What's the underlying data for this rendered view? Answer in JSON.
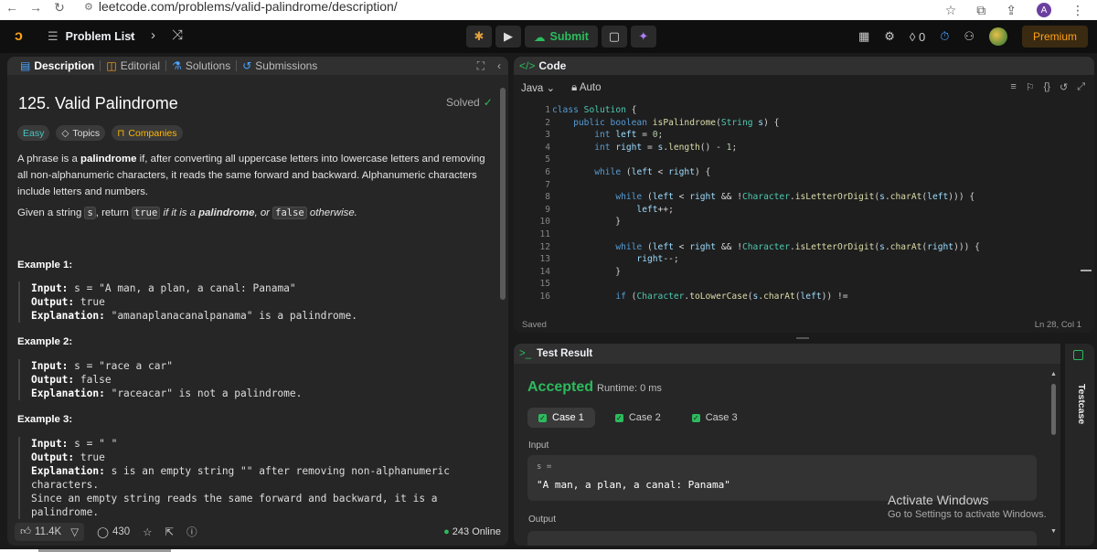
{
  "browser": {
    "url": "leetcode.com/problems/valid-palindrome/description/",
    "account_initial": "A"
  },
  "topnav": {
    "problem_list": "Problem List",
    "submit": "Submit",
    "streak_count": "0",
    "premium": "Premium"
  },
  "left_tabs": [
    {
      "label": "Description",
      "icon": "file-icon"
    },
    {
      "label": "Editorial",
      "icon": "book-icon"
    },
    {
      "label": "Solutions",
      "icon": "flask-icon"
    },
    {
      "label": "Submissions",
      "icon": "history-icon"
    }
  ],
  "problem": {
    "title": "125. Valid Palindrome",
    "status": "Solved",
    "difficulty": "Easy",
    "topics": "Topics",
    "companies": "Companies",
    "desc_a": "A phrase is a ",
    "desc_b": "palindrome",
    "desc_c": " if, after converting all uppercase letters into lowercase letters and removing all non-alphanumeric characters, it reads the same forward and backward. Alphanumeric characters include letters and numbers.",
    "q1": "Given a string ",
    "q_s": "s",
    "q2": ", return ",
    "q_true": "true",
    "q3": " if it is a ",
    "q_pal": "palindrome",
    "q4": ", or ",
    "q_false": "false",
    "q5": " otherwise.",
    "examples": [
      {
        "heading": "Example 1:",
        "input": "s = \"A man, a plan, a canal: Panama\"",
        "output": "true",
        "explanation": "\"amanaplanacanalpanama\" is a palindrome."
      },
      {
        "heading": "Example 2:",
        "input": "s = \"race a car\"",
        "output": "false",
        "explanation": "\"raceacar\" is not a palindrome."
      },
      {
        "heading": "Example 3:",
        "input": "s = \" \"",
        "output": "true",
        "explanation": "s is an empty string \"\" after removing non-alphanumeric characters.",
        "explanation2": "Since an empty string reads the same forward and backward, it is a palindrome."
      }
    ],
    "labels": {
      "input": "Input:",
      "output": "Output:",
      "explanation": "Explanation:"
    }
  },
  "footer": {
    "likes": "11.4K",
    "comments": "430",
    "online": "243 Online"
  },
  "code": {
    "header": "Code",
    "language": "Java",
    "mode": "Auto",
    "saved": "Saved",
    "cursor": "Ln 28, Col 1",
    "line_numbers": [
      "1",
      "2",
      "3",
      "4",
      "5",
      "6",
      "7",
      "8",
      "9",
      "10",
      "11",
      "12",
      "13",
      "14",
      "15",
      "16"
    ]
  },
  "result": {
    "header": "Test Result",
    "verdict": "Accepted",
    "runtime": "Runtime: 0 ms",
    "cases": [
      "Case 1",
      "Case 2",
      "Case 3"
    ],
    "input_label": "Input",
    "var_label": "s =",
    "input_value": "\"A man, a plan, a canal: Panama\"",
    "output_label": "Output"
  },
  "side_tab": "Testcase",
  "watermark": {
    "line1": "Activate Windows",
    "line2": "Go to Settings to activate Windows."
  },
  "colors": {
    "accent_green": "#2cbb5d",
    "brand_orange": "#ffa116",
    "easy_teal": "#46c6c2"
  }
}
